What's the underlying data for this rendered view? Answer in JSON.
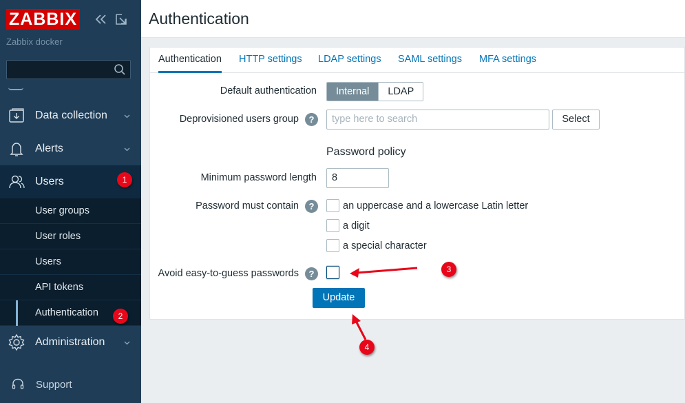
{
  "app": {
    "logo": "ZABBIX",
    "server_name": "Zabbix docker"
  },
  "sidebar": {
    "search_value": "",
    "items": [
      {
        "label": "Data collection"
      },
      {
        "label": "Alerts"
      },
      {
        "label": "Users"
      },
      {
        "label": "Administration"
      }
    ],
    "users_submenu": [
      "User groups",
      "User roles",
      "Users",
      "API tokens",
      "Authentication"
    ],
    "support": "Support"
  },
  "header": {
    "title": "Authentication"
  },
  "tabs": [
    "Authentication",
    "HTTP settings",
    "LDAP settings",
    "SAML settings",
    "MFA settings"
  ],
  "form": {
    "default_auth_label": "Default authentication",
    "default_auth_options": [
      "Internal",
      "LDAP"
    ],
    "default_auth_selected": "Internal",
    "deprovisioned_label": "Deprovisioned users group",
    "deprovisioned_placeholder": "type here to search",
    "select_button": "Select",
    "password_policy_title": "Password policy",
    "min_length_label": "Minimum password length",
    "min_length_value": "8",
    "must_contain_label": "Password must contain",
    "must_contain_options": [
      "an uppercase and a lowercase Latin letter",
      "a digit",
      "a special character"
    ],
    "avoid_label": "Avoid easy-to-guess passwords",
    "update_button": "Update",
    "help": "?"
  },
  "annotations": [
    "1",
    "2",
    "3",
    "4"
  ],
  "colors": {
    "brand": "#d40000",
    "sidebar": "#1f3d57",
    "accent": "#0275b8",
    "badge": "#e8071a"
  }
}
